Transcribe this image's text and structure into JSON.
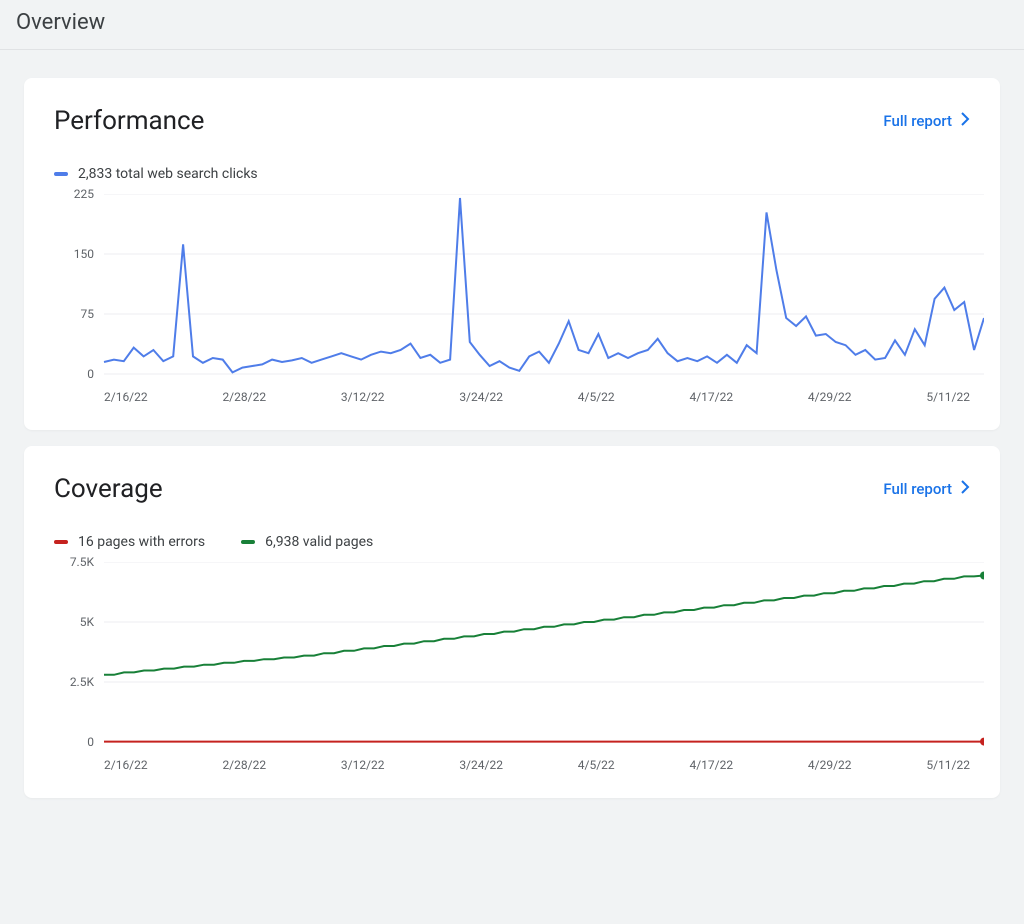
{
  "page": {
    "title": "Overview"
  },
  "performance": {
    "title": "Performance",
    "full_report": "Full report",
    "legend": {
      "clicks": "2,833 total web search clicks"
    }
  },
  "coverage": {
    "title": "Coverage",
    "full_report": "Full report",
    "legend": {
      "errors": "16 pages with errors",
      "valid": "6,938 valid pages"
    }
  },
  "colors": {
    "blue": "#4f7de9",
    "green": "#188038",
    "red": "#c5221f",
    "link": "#1a73e8"
  },
  "chart_data": [
    {
      "id": "performance",
      "type": "line",
      "title": "Performance",
      "ylabel": "clicks",
      "ylim": [
        0,
        225
      ],
      "y_ticks": [
        0,
        75,
        150,
        225
      ],
      "x_tick_labels": [
        "2/16/22",
        "2/28/22",
        "3/12/22",
        "3/24/22",
        "4/5/22",
        "4/17/22",
        "4/29/22",
        "5/11/22"
      ],
      "x": [
        0,
        1,
        2,
        3,
        4,
        5,
        6,
        7,
        8,
        9,
        10,
        11,
        12,
        13,
        14,
        15,
        16,
        17,
        18,
        19,
        20,
        21,
        22,
        23,
        24,
        25,
        26,
        27,
        28,
        29,
        30,
        31,
        32,
        33,
        34,
        35,
        36,
        37,
        38,
        39,
        40,
        41,
        42,
        43,
        44,
        45,
        46,
        47,
        48,
        49,
        50,
        51,
        52,
        53,
        54,
        55,
        56,
        57,
        58,
        59,
        60,
        61,
        62,
        63,
        64,
        65,
        66,
        67,
        68,
        69,
        70,
        71,
        72,
        73,
        74,
        75,
        76,
        77,
        78,
        79,
        80,
        81,
        82,
        83,
        84,
        85,
        86,
        87,
        88,
        89
      ],
      "series": [
        {
          "name": "total web search clicks",
          "color": "#4f7de9",
          "values": [
            15,
            18,
            16,
            33,
            22,
            30,
            16,
            22,
            162,
            22,
            14,
            20,
            18,
            2,
            8,
            10,
            12,
            18,
            15,
            17,
            20,
            14,
            18,
            22,
            26,
            22,
            18,
            24,
            28,
            26,
            30,
            38,
            20,
            24,
            14,
            18,
            220,
            40,
            24,
            10,
            16,
            8,
            4,
            22,
            28,
            14,
            38,
            66,
            30,
            26,
            50,
            20,
            26,
            20,
            26,
            30,
            44,
            26,
            16,
            20,
            16,
            22,
            14,
            24,
            14,
            36,
            26,
            202,
            130,
            70,
            60,
            72,
            48,
            50,
            40,
            36,
            24,
            30,
            18,
            20,
            42,
            24,
            56,
            36,
            94,
            108,
            80,
            90,
            30,
            70
          ]
        }
      ]
    },
    {
      "id": "coverage",
      "type": "line",
      "title": "Coverage",
      "ylabel": "pages",
      "ylim": [
        0,
        7500
      ],
      "y_ticks": [
        0,
        2500,
        5000,
        7500
      ],
      "y_tick_labels": [
        "0",
        "2.5K",
        "5K",
        "7.5K"
      ],
      "x_tick_labels": [
        "2/16/22",
        "2/28/22",
        "3/12/22",
        "3/24/22",
        "4/5/22",
        "4/17/22",
        "4/29/22",
        "5/11/22"
      ],
      "x": [
        0,
        1,
        2,
        3,
        4,
        5,
        6,
        7,
        8,
        9,
        10,
        11,
        12,
        13,
        14,
        15,
        16,
        17,
        18,
        19,
        20,
        21,
        22,
        23,
        24,
        25,
        26,
        27,
        28,
        29,
        30,
        31,
        32,
        33,
        34,
        35,
        36,
        37,
        38,
        39,
        40,
        41,
        42,
        43,
        44,
        45,
        46,
        47,
        48,
        49,
        50,
        51,
        52,
        53,
        54,
        55,
        56,
        57,
        58,
        59,
        60,
        61,
        62,
        63,
        64,
        65,
        66,
        67,
        68,
        69,
        70,
        71,
        72,
        73,
        74,
        75,
        76,
        77,
        78,
        79,
        80,
        81,
        82,
        83,
        84,
        85,
        86,
        87,
        88
      ],
      "series": [
        {
          "name": "pages with errors",
          "color": "#c5221f",
          "values": [
            16,
            16,
            16,
            16,
            16,
            16,
            16,
            16,
            16,
            16,
            16,
            16,
            16,
            16,
            16,
            16,
            16,
            16,
            16,
            16,
            16,
            16,
            16,
            16,
            16,
            16,
            16,
            16,
            16,
            16,
            16,
            16,
            16,
            16,
            16,
            16,
            16,
            16,
            16,
            16,
            16,
            16,
            16,
            16,
            16,
            16,
            16,
            16,
            16,
            16,
            16,
            16,
            16,
            16,
            16,
            16,
            16,
            16,
            16,
            16,
            16,
            16,
            16,
            16,
            16,
            16,
            16,
            16,
            16,
            16,
            16,
            16,
            16,
            16,
            16,
            16,
            16,
            16,
            16,
            16,
            16,
            16,
            16,
            16,
            16,
            16,
            16,
            16,
            16
          ]
        },
        {
          "name": "valid pages",
          "color": "#188038",
          "values": [
            2800,
            2800,
            2900,
            2900,
            2980,
            2980,
            3060,
            3060,
            3140,
            3140,
            3220,
            3220,
            3300,
            3300,
            3380,
            3380,
            3450,
            3450,
            3520,
            3520,
            3600,
            3600,
            3700,
            3700,
            3800,
            3800,
            3900,
            3900,
            4000,
            4000,
            4100,
            4100,
            4200,
            4200,
            4300,
            4300,
            4400,
            4400,
            4500,
            4500,
            4600,
            4600,
            4700,
            4700,
            4800,
            4800,
            4900,
            4900,
            5000,
            5000,
            5100,
            5100,
            5200,
            5200,
            5300,
            5300,
            5400,
            5400,
            5500,
            5500,
            5600,
            5600,
            5700,
            5700,
            5800,
            5800,
            5900,
            5900,
            6000,
            6000,
            6100,
            6100,
            6200,
            6200,
            6300,
            6300,
            6400,
            6400,
            6500,
            6500,
            6600,
            6600,
            6700,
            6700,
            6800,
            6800,
            6900,
            6900,
            6938
          ]
        }
      ],
      "end_markers": true
    }
  ]
}
